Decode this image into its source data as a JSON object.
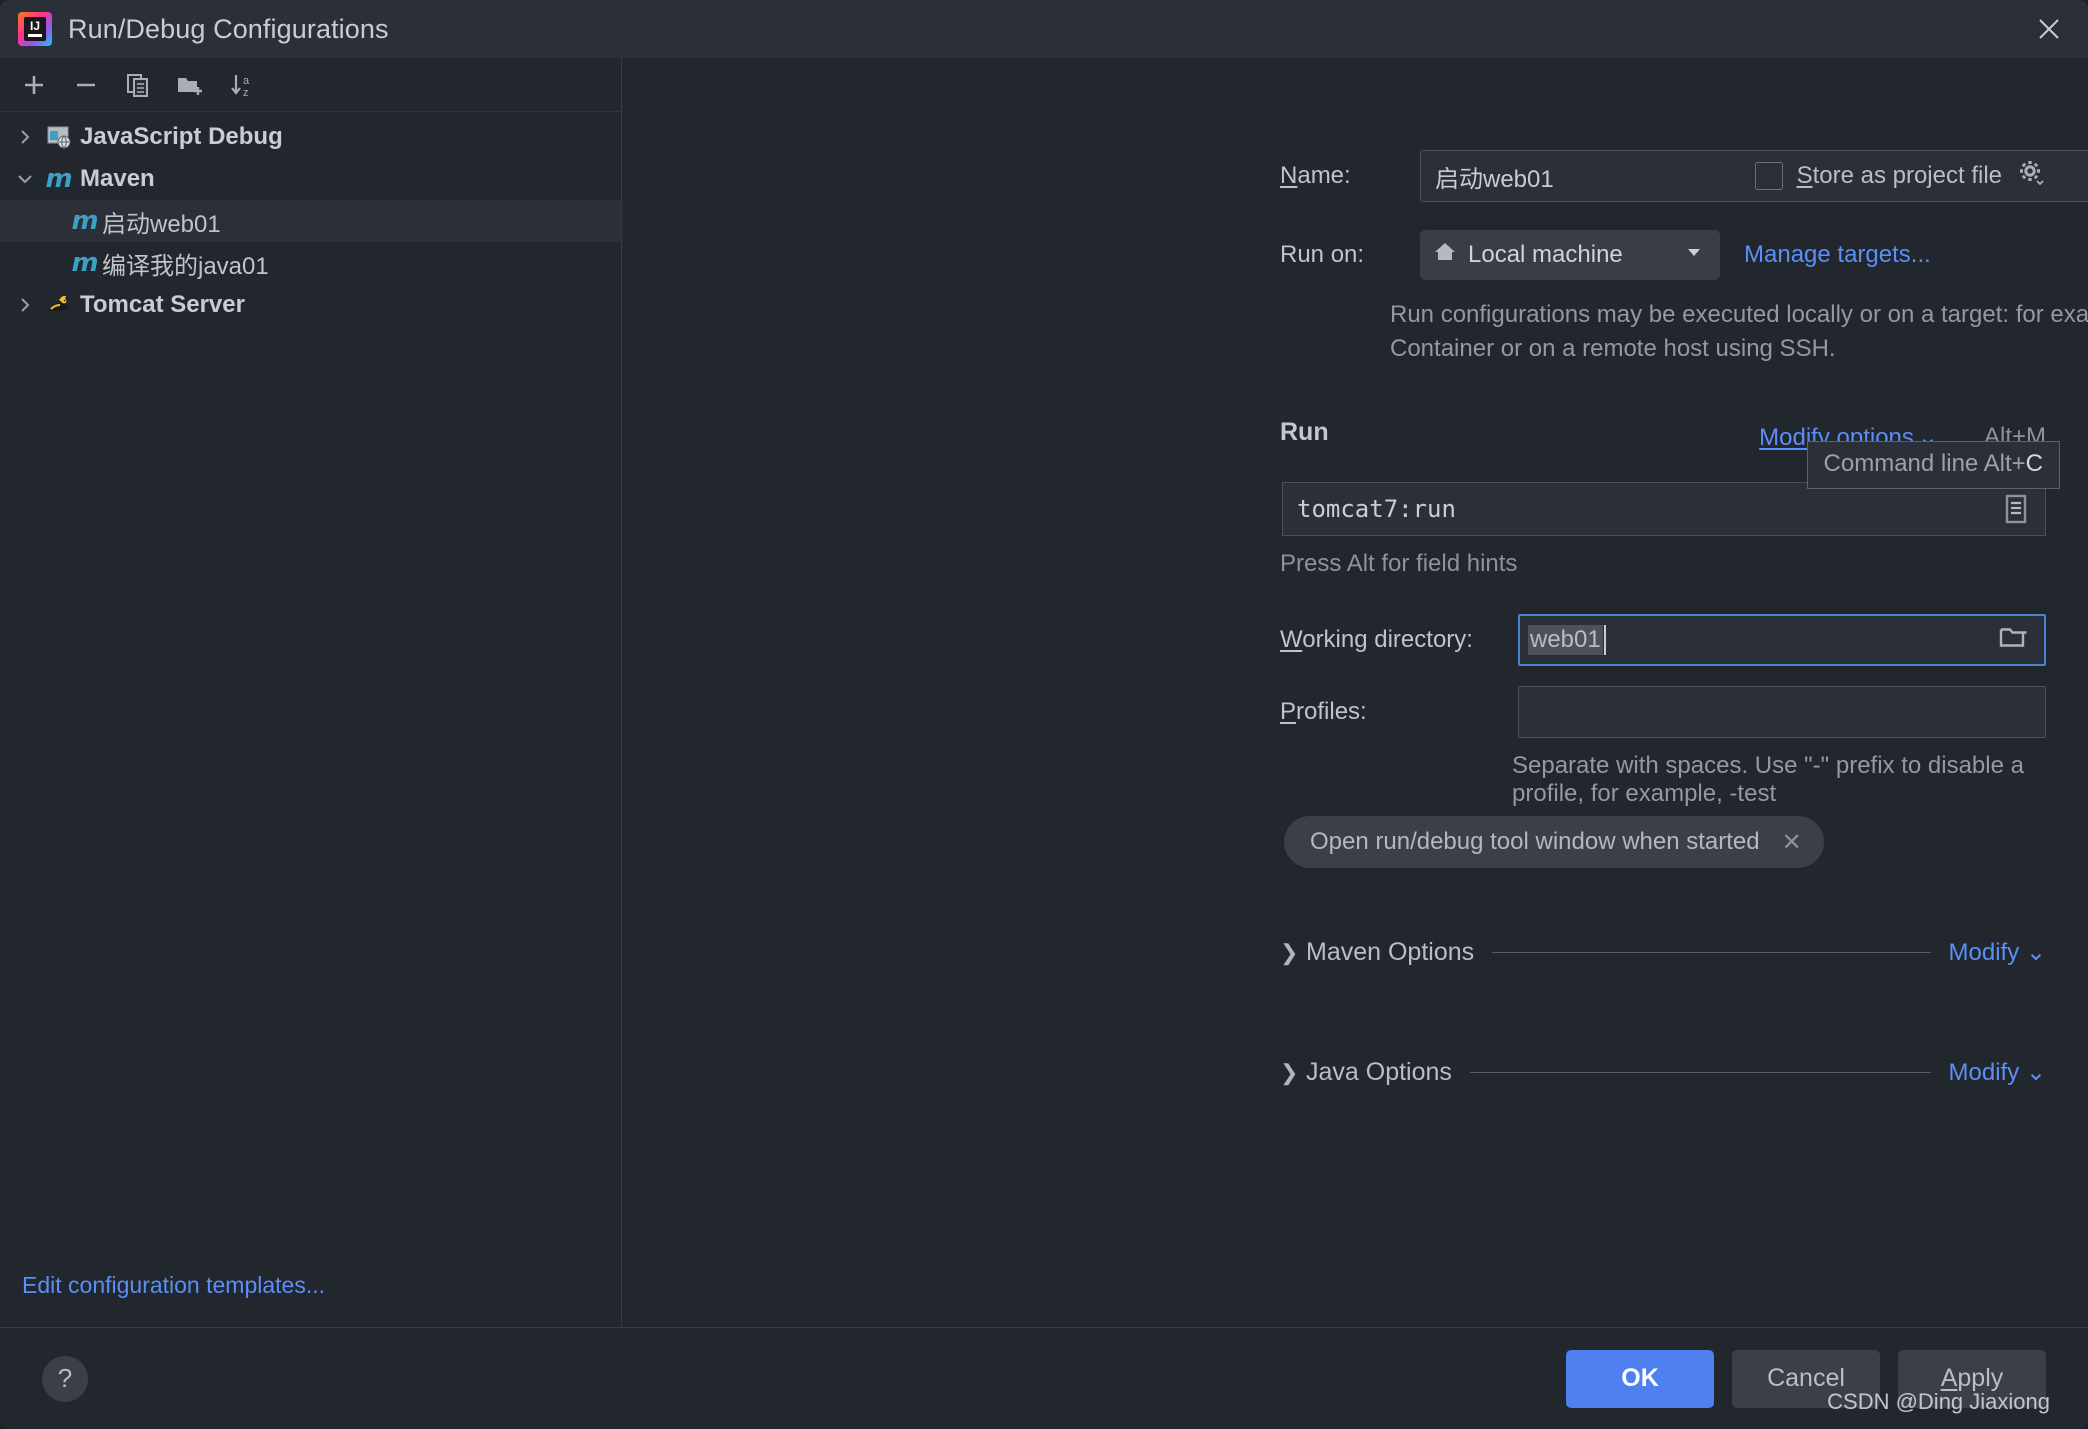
{
  "window": {
    "title": "Run/Debug Configurations",
    "app_icon": "intellij-idea-icon",
    "close_icon": "close-icon"
  },
  "sidebar": {
    "toolbar": [
      {
        "name": "add-configuration-button",
        "icon": "plus-icon"
      },
      {
        "name": "remove-configuration-button",
        "icon": "minus-icon"
      },
      {
        "name": "copy-configuration-button",
        "icon": "copy-icon"
      },
      {
        "name": "new-folder-button",
        "icon": "folder-add-icon"
      },
      {
        "name": "sort-configurations-button",
        "icon": "sort-az-icon"
      }
    ],
    "tree": [
      {
        "label": "JavaScript Debug",
        "type": "group",
        "expanded": false,
        "icon": "javascript-debug-icon"
      },
      {
        "label": "Maven",
        "type": "group",
        "expanded": true,
        "icon": "maven-icon"
      },
      {
        "label": "启动web01",
        "type": "child",
        "selected": true,
        "icon": "maven-icon"
      },
      {
        "label": "编译我的java01",
        "type": "child",
        "selected": false,
        "icon": "maven-icon"
      },
      {
        "label": "Tomcat Server",
        "type": "group",
        "expanded": false,
        "icon": "tomcat-icon"
      }
    ],
    "edit_templates": "Edit configuration templates..."
  },
  "form": {
    "name_label": "Name:",
    "name_value": "启动web01",
    "store_as_project_file_label": "Store as project file",
    "store_as_project_file_checked": false,
    "store_gear_icon": "gear-icon",
    "run_on_label": "Run on:",
    "run_on_value": "Local machine",
    "run_on_icon": "home-icon",
    "manage_targets_label": "Manage targets...",
    "help_text": "Run configurations may be executed locally or on a target: for example in a Docker Container or on a remote host using SSH.",
    "run_section_title": "Run",
    "modify_options_label": "Modify options",
    "modify_options_shortcut": "Alt+M",
    "tooltip_text": "Command line Alt+",
    "tooltip_accel": "C",
    "command_line_value": "tomcat7:run",
    "command_expand_icon": "expand-editor-icon",
    "press_alt_hint": "Press Alt for field hints",
    "working_directory_label": "Working directory:",
    "working_directory_value": "web01",
    "browse_icon": "folder-icon",
    "profiles_label": "Profiles:",
    "profiles_value": "",
    "profiles_hint": "Separate with spaces. Use \"-\" prefix to disable a profile, for example, -test",
    "tag_label": "Open run/debug tool window when started",
    "tag_remove_icon": "close-small-icon",
    "sections": [
      {
        "title": "Maven Options",
        "modify_label": "Modify",
        "expanded": false
      },
      {
        "title": "Java Options",
        "modify_label": "Modify",
        "expanded": false
      }
    ]
  },
  "footer": {
    "help_label": "?",
    "ok_label": "OK",
    "cancel_label": "Cancel",
    "apply_label": "Apply",
    "watermark": "CSDN @Ding Jiaxiong"
  },
  "colors": {
    "window_bg": "#22262d",
    "titlebar_bg": "#2b2f38",
    "accent_blue": "#5a8ff5",
    "primary_button": "#4e80f0",
    "focus_border": "#4a81d8",
    "maven_icon": "#3d9fc4"
  }
}
